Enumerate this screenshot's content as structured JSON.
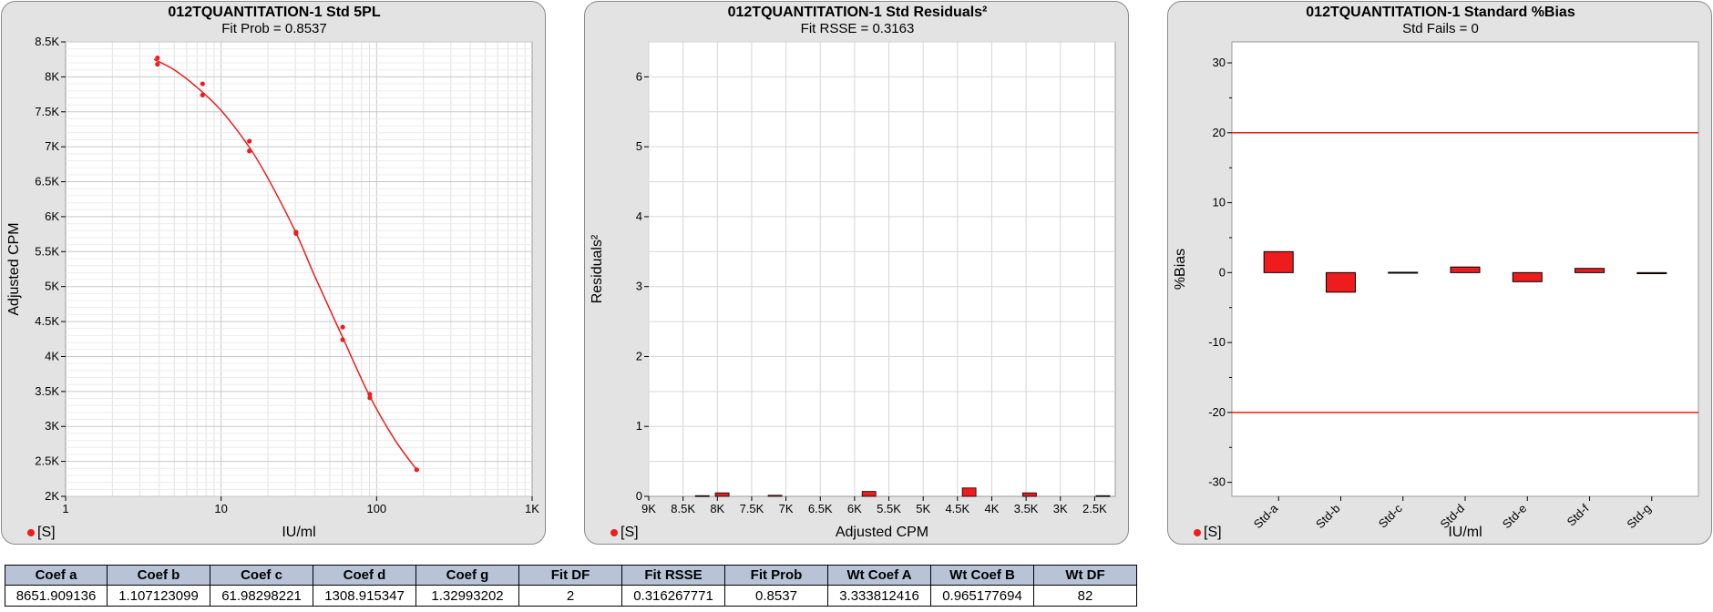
{
  "chart_data": [
    {
      "type": "scatter",
      "title": "012TQUANTITATION-1 Std 5PL",
      "subtitle": "Fit Prob = 0.8537",
      "xlabel": "IU/ml",
      "ylabel": "Adjusted CPM",
      "x_scale": "log",
      "xlim": [
        1,
        1000
      ],
      "ylim": [
        2000,
        8500
      ],
      "x_ticks": [
        "1",
        "10",
        "100",
        "1K"
      ],
      "y_ticks": [
        "2K",
        "2.5K",
        "3K",
        "3.5K",
        "4K",
        "4.5K",
        "5K",
        "5.5K",
        "6K",
        "6.5K",
        "7K",
        "7.5K",
        "8K",
        "8.5K"
      ],
      "grid": true,
      "legend": "[S]",
      "legend_position": "bottom-left",
      "color": "#ee1c1c",
      "points": [
        {
          "x": 3.9,
          "y": 8270
        },
        {
          "x": 3.9,
          "y": 8180
        },
        {
          "x": 7.6,
          "y": 7900
        },
        {
          "x": 7.6,
          "y": 7740
        },
        {
          "x": 15.2,
          "y": 7080
        },
        {
          "x": 15.2,
          "y": 6940
        },
        {
          "x": 30.3,
          "y": 5780
        },
        {
          "x": 30.3,
          "y": 5760
        },
        {
          "x": 60.5,
          "y": 4420
        },
        {
          "x": 60.5,
          "y": 4240
        },
        {
          "x": 90.5,
          "y": 3460
        },
        {
          "x": 90.5,
          "y": 3410
        },
        {
          "x": 181,
          "y": 2380
        }
      ],
      "fit_curve": [
        {
          "x": 3.7,
          "y": 8250
        },
        {
          "x": 5,
          "y": 8100
        },
        {
          "x": 7,
          "y": 7850
        },
        {
          "x": 10,
          "y": 7520
        },
        {
          "x": 15,
          "y": 7010
        },
        {
          "x": 20,
          "y": 6550
        },
        {
          "x": 30,
          "y": 5790
        },
        {
          "x": 40,
          "y": 5150
        },
        {
          "x": 60,
          "y": 4290
        },
        {
          "x": 90,
          "y": 3440
        },
        {
          "x": 130,
          "y": 2820
        },
        {
          "x": 181,
          "y": 2380
        }
      ]
    },
    {
      "type": "bar",
      "title": "012TQUANTITATION-1 Std  Residuals²",
      "subtitle": "Fit RSSE = 0.3163",
      "xlabel": "Adjusted CPM",
      "ylabel": "Residuals²",
      "xlim": [
        9000,
        2200
      ],
      "ylim": [
        0,
        6.5
      ],
      "x_ticks": [
        "9K",
        "8.5K",
        "8K",
        "7.5K",
        "7K",
        "6.5K",
        "6K",
        "5.5K",
        "5K",
        "4.5K",
        "4K",
        "3.5K",
        "3K",
        "2.5K"
      ],
      "y_ticks": [
        "0",
        "1",
        "2",
        "3",
        "4",
        "5",
        "6"
      ],
      "grid": true,
      "legend": "[S]",
      "legend_position": "bottom-left",
      "color": "#ee1c1c",
      "bars": [
        {
          "x": 8220,
          "y": 0.01
        },
        {
          "x": 7930,
          "y": 0.05
        },
        {
          "x": 7160,
          "y": 0.015
        },
        {
          "x": 5790,
          "y": 0.07
        },
        {
          "x": 4330,
          "y": 0.12
        },
        {
          "x": 3450,
          "y": 0.05
        },
        {
          "x": 2380,
          "y": 0.01
        }
      ]
    },
    {
      "type": "bar",
      "title": "012TQUANTITATION-1 Standard %Bias",
      "subtitle": "Std Fails = 0",
      "xlabel": "IU/ml",
      "ylabel": "%Bias",
      "ylim": [
        -32,
        33
      ],
      "y_ticks": [
        "30",
        "20",
        "10",
        "0",
        "-10",
        "-20",
        "-30"
      ],
      "grid": false,
      "limit_lines": [
        20,
        -20
      ],
      "categories": [
        "Std-a",
        "Std-b",
        "Std-c",
        "Std-d",
        "Std-e",
        "Std-f",
        "Std-g"
      ],
      "values": [
        3.0,
        -2.8,
        0.05,
        0.8,
        -1.3,
        0.6,
        -0.15
      ],
      "legend": "[S]",
      "legend_position": "bottom-left",
      "color": "#ee1c1c"
    }
  ],
  "table": {
    "headers": [
      "Coef a",
      "Coef b",
      "Coef c",
      "Coef d",
      "Coef g",
      "Fit DF",
      "Fit RSSE",
      "Fit Prob",
      "Wt Coef A",
      "Wt Coef B",
      "Wt DF"
    ],
    "values": [
      "8651.909136",
      "1.107123099",
      "61.98298221",
      "1308.915347",
      "1.32993202",
      "2",
      "0.316267771",
      "0.8537",
      "3.333812416",
      "0.965177694",
      "82"
    ]
  }
}
